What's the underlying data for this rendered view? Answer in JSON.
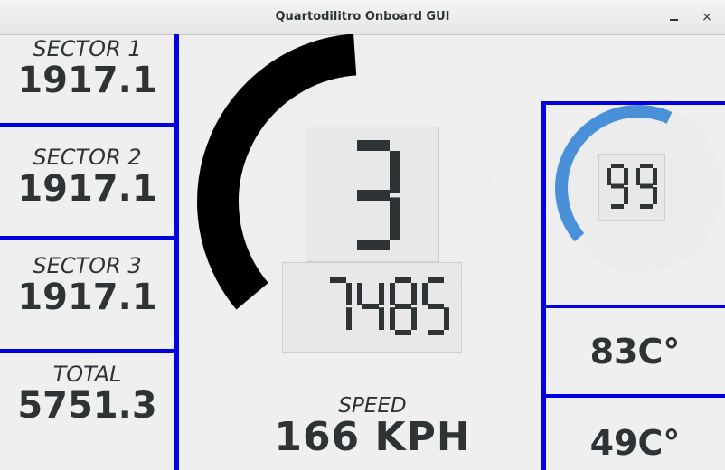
{
  "window": {
    "title": "Quartodilitro Onboard GUI",
    "minimize_glyph": "minimize-icon",
    "close_glyph": "×"
  },
  "sectors": [
    {
      "label": "SECTOR 1",
      "value": "1917.1"
    },
    {
      "label": "SECTOR 2",
      "value": "1917.1"
    },
    {
      "label": "SECTOR 3",
      "value": "1917.1"
    },
    {
      "label": "TOTAL",
      "value": "5751.3"
    }
  ],
  "gauge": {
    "rpm_arc_fraction": 0.42,
    "gear": "3",
    "rpm": "7485",
    "rpm_color": "#000000"
  },
  "speed": {
    "label": "SPEED",
    "value": "166 KPH"
  },
  "throttle": {
    "value": "99",
    "arc_fraction": 0.55,
    "color": "#4a90d9"
  },
  "temps": {
    "temp1": "83C°",
    "temp2": "49C°"
  },
  "colors": {
    "divider": "#0000e0",
    "background": "#efefef",
    "text": "#2e3436"
  }
}
